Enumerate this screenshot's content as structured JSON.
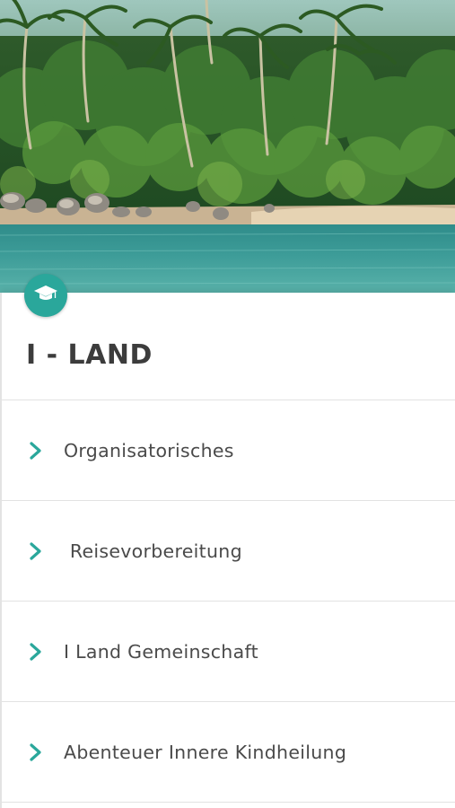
{
  "colors": {
    "accent": "#2aa79b",
    "title_text": "#3c3c3c",
    "item_text": "#4a4a4a",
    "divider": "#e2e2e2"
  },
  "hero": {
    "icon": "tropical-island-image"
  },
  "badge": {
    "icon": "graduation-cap-icon"
  },
  "course": {
    "title": "I - LAND"
  },
  "menu": {
    "icon": "chevron-right-icon",
    "items": [
      {
        "label": "Organisatorisches"
      },
      {
        "label": " Reisevorbereitung"
      },
      {
        "label": "I Land Gemeinschaft"
      },
      {
        "label": "Abenteuer Innere Kindheilung"
      }
    ]
  }
}
